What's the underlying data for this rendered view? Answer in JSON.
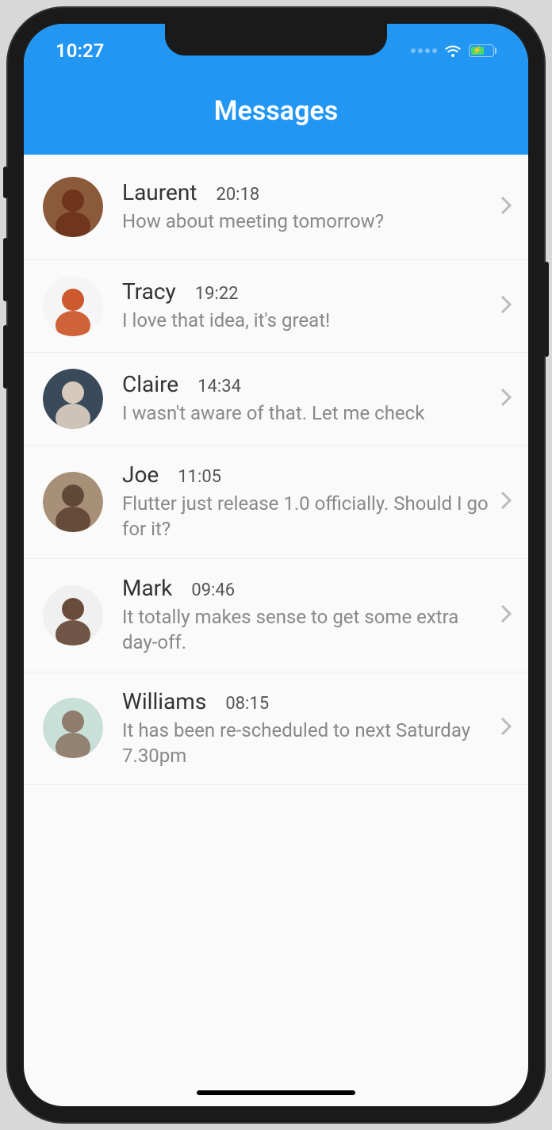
{
  "status_bar": {
    "time": "10:27"
  },
  "header": {
    "title": "Messages"
  },
  "messages": [
    {
      "name": "Laurent",
      "time": "20:18",
      "preview": "How about meeting tomorrow?",
      "avatar_bg": "#8a5a3a",
      "avatar_accent": "#6b3018"
    },
    {
      "name": "Tracy",
      "time": "19:22",
      "preview": "I love that idea, it's great!",
      "avatar_bg": "#f5f5f5",
      "avatar_accent": "#c94818"
    },
    {
      "name": "Claire",
      "time": "14:34",
      "preview": "I wasn't aware of that. Let me check",
      "avatar_bg": "#3a4a5a",
      "avatar_accent": "#e8d8c8"
    },
    {
      "name": "Joe",
      "time": "11:05",
      "preview": "Flutter just release 1.0 officially. Should I go for it?",
      "avatar_bg": "#a89078",
      "avatar_accent": "#5a4030"
    },
    {
      "name": "Mark",
      "time": "09:46",
      "preview": "It totally makes sense to get some extra day-off.",
      "avatar_bg": "#f0f0f0",
      "avatar_accent": "#5a3a28"
    },
    {
      "name": "Williams",
      "time": "08:15",
      "preview": "It has been re-scheduled to next Saturday 7.30pm",
      "avatar_bg": "#c8e0d8",
      "avatar_accent": "#8a7060"
    }
  ]
}
